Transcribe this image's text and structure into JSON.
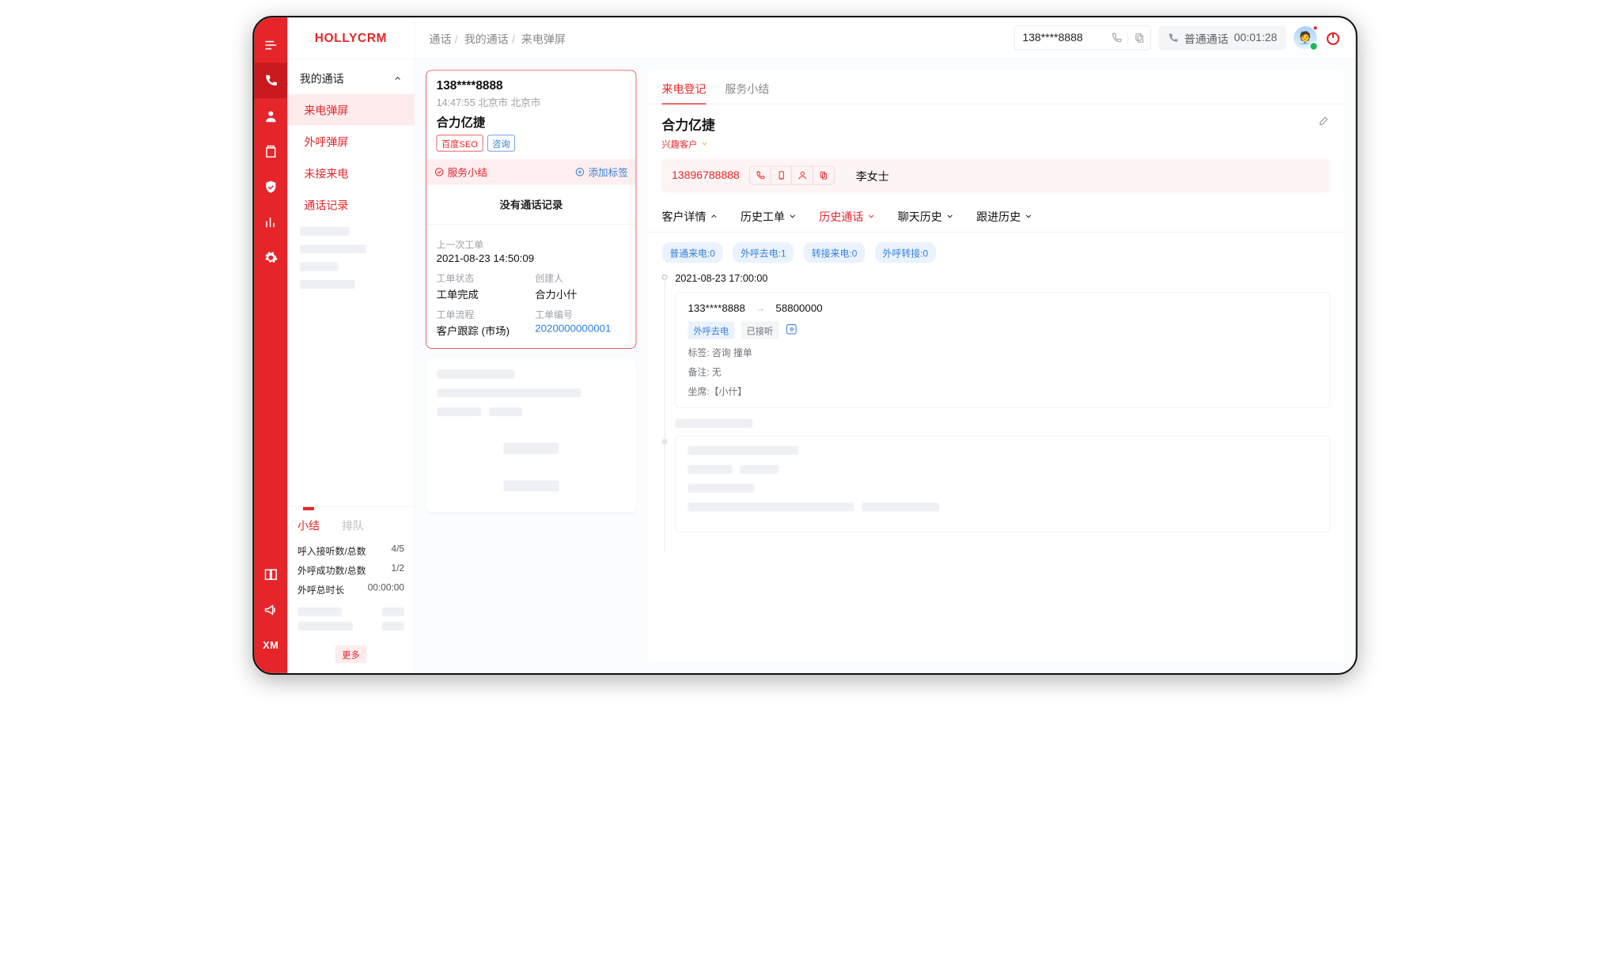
{
  "brand": "HOLLYCRM",
  "breadcrumbs": [
    "通话",
    "我的通话",
    "来电弹屏"
  ],
  "search": {
    "value": "138****8888"
  },
  "callStatus": {
    "label": "普通通话",
    "timer": "00:01:28"
  },
  "rail": {
    "xm": "XM"
  },
  "nav": {
    "header": "我的通话",
    "items": [
      "来电弹屏",
      "外呼弹屏",
      "未接来电",
      "通话记录"
    ]
  },
  "bottomTabs": {
    "active": "小结",
    "inactive": "排队"
  },
  "stats": {
    "r1l": "呼入接听数/总数",
    "r1v": "4/5",
    "r2l": "外呼成功数/总数",
    "r2v": "1/2",
    "r3l": "外呼总时长",
    "r3v": "00:00:00",
    "more": "更多"
  },
  "callCard": {
    "phone": "138****8888",
    "meta": "14:47:55 北京市  北京市",
    "company": "合力亿捷",
    "tag1": "百度SEO",
    "tag2": "咨询",
    "summaryLabel": "服务小结",
    "addTag": "添加标签",
    "empty": "没有通话记录",
    "lastTicketLbl": "上一次工单",
    "lastTicketVal": "2021-08-23 14:50:09",
    "statusLbl": "工单状态",
    "creatorLbl": "创建人",
    "statusVal": "工单完成",
    "creatorVal": "合力小什",
    "flowLbl": "工单流程",
    "numLbl": "工单编号",
    "flowVal": "客户跟踪 (市场)",
    "numVal": "2020000000001"
  },
  "rightTabs": {
    "t1": "来电登记",
    "t2": "服务小结"
  },
  "customer": {
    "name": "合力亿捷",
    "type": "兴趣客户",
    "phone": "13896788888",
    "contact": "李女士"
  },
  "detailTabs": [
    "客户详情",
    "历史工单",
    "历史通话",
    "聊天历史",
    "跟进历史"
  ],
  "chips": [
    "普通来电:0",
    "外呼去电:1",
    "转接来电:0",
    "外呼转接:0"
  ],
  "timeline": {
    "time": "2021-08-23  17:00:00",
    "from": "133****8888",
    "to": "58800000",
    "badge1": "外呼去电",
    "badge2": "已接听",
    "tagsLbl": "标签:",
    "tagsVal": "咨询   撞单",
    "noteLbl": "备注:",
    "noteVal": "无",
    "agentLbl": "坐席:",
    "agentVal": "【小什】"
  }
}
